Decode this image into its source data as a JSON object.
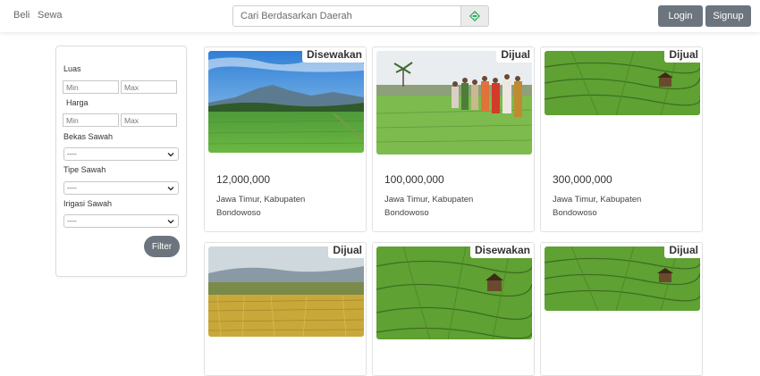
{
  "header": {
    "nav": [
      "Beli",
      "Sewa"
    ],
    "search_placeholder": "Cari Berdasarkan Daerah",
    "login_label": "Login",
    "signup_label": "Signup"
  },
  "filter": {
    "luas_label": "Luas",
    "harga_label": "Harga",
    "min_placeholder": "Min",
    "max_placeholder": "Max",
    "bekas_sawah_label": "Bekas Sawah",
    "tipe_sawah_label": "Tipe Sawah",
    "irigasi_sawah_label": "Irigasi Sawah",
    "select_default": "----",
    "filter_button": "Filter"
  },
  "listings": [
    {
      "badge": "Disewakan",
      "price": "12,000,000",
      "location": "Jawa Timur, Kabupaten Bondowoso",
      "image": "green-rice-field-mountains"
    },
    {
      "badge": "Dijual",
      "price": "100,000,000",
      "location": "Jawa Timur, Kabupaten Bondowoso",
      "image": "farmers-in-rice-field"
    },
    {
      "badge": "Dijual",
      "price": "300,000,000",
      "location": "Jawa Timur, Kabupaten Bondowoso",
      "image": "terraced-rice-field-aerial"
    },
    {
      "badge": "Dijual",
      "image": "golden-rice-field"
    },
    {
      "badge": "Disewakan",
      "image": "terraced-rice-field-aerial"
    },
    {
      "badge": "Dijual",
      "image": "terraced-rice-field-aerial"
    }
  ],
  "colors": {
    "button_gray": "#6c757d",
    "search_icon": "#2eaa5c"
  }
}
